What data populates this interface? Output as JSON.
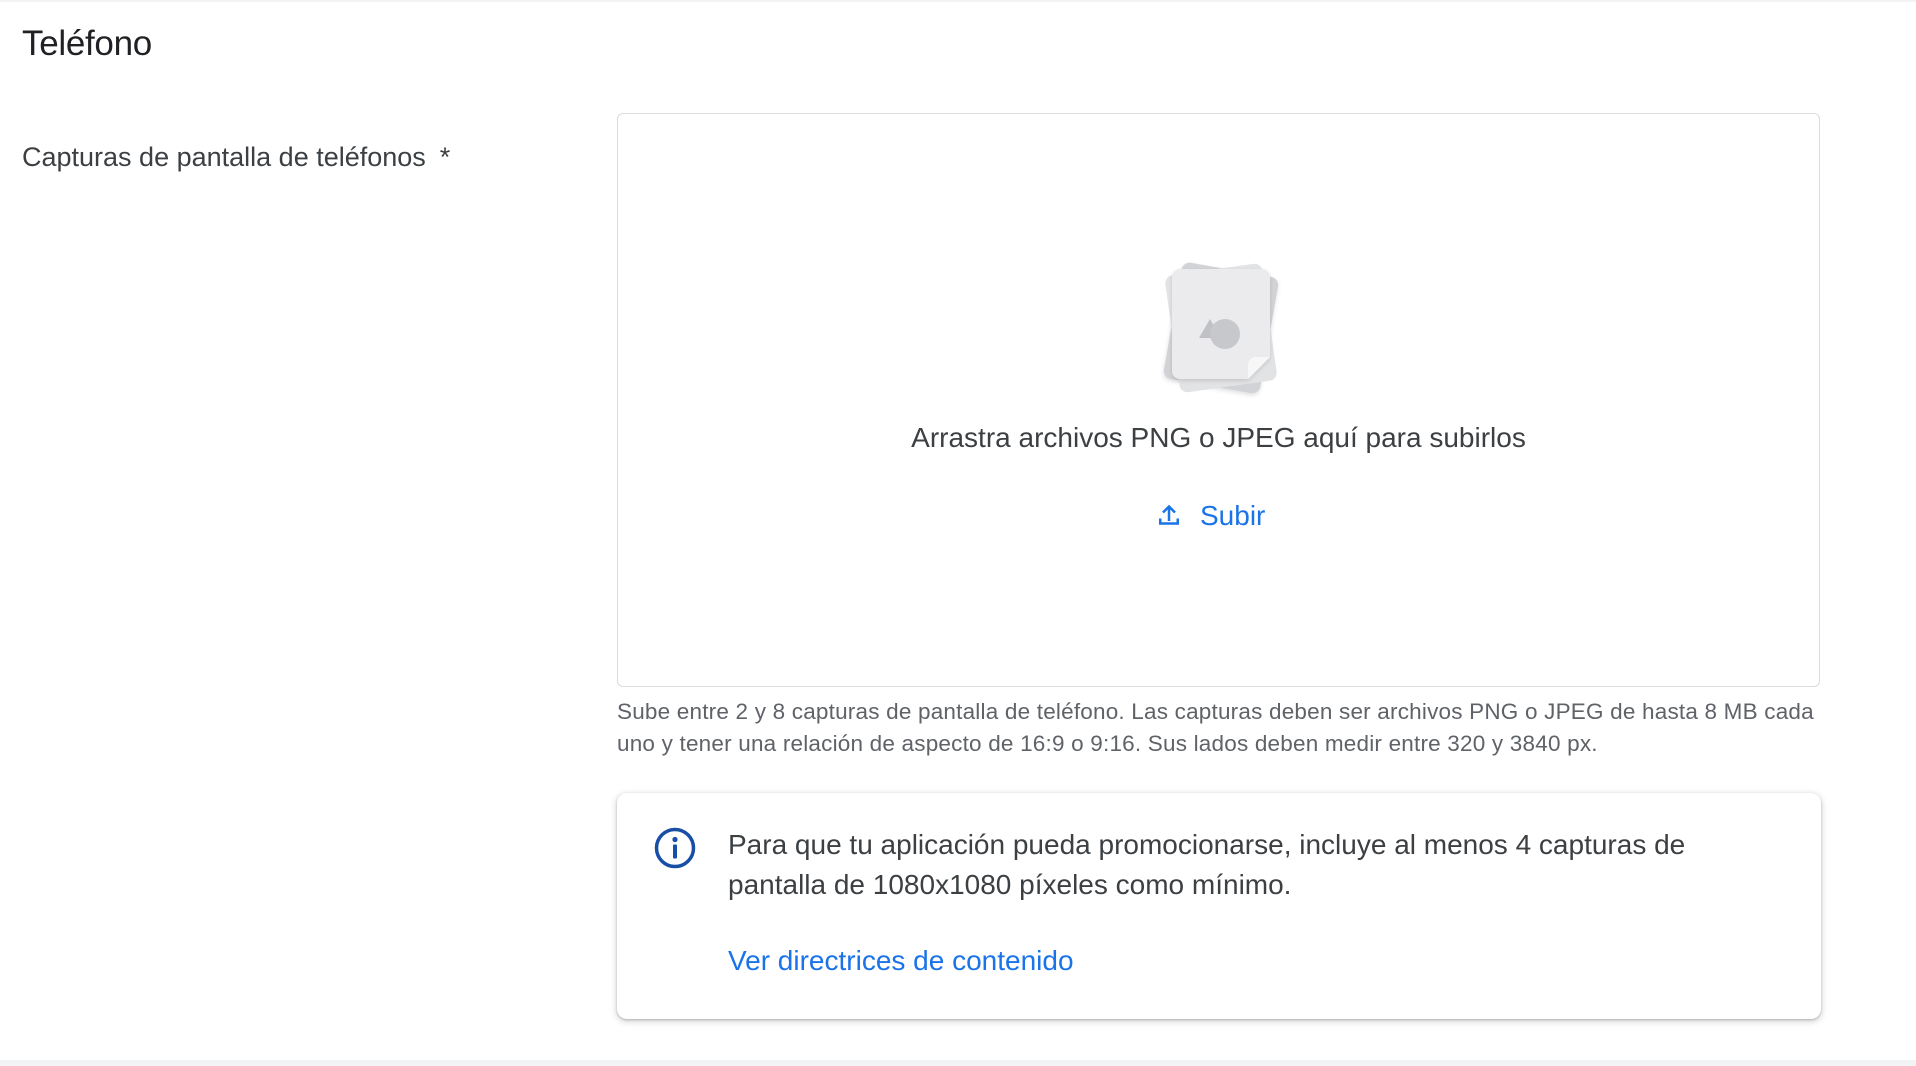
{
  "section": {
    "title": "Teléfono"
  },
  "field": {
    "label": "Capturas de pantalla de teléfonos",
    "required_marker": "*"
  },
  "dropzone": {
    "icon": "image-files-icon",
    "drop_text": "Arrastra archivos PNG o JPEG aquí para subirlos",
    "upload_icon": "upload-icon",
    "upload_label": "Subir"
  },
  "hint": {
    "text": "Sube entre 2 y 8 capturas de pantalla de teléfono. Las capturas deben ser archivos PNG o JPEG de hasta 8 MB cada uno y tener una relación de aspecto de 16:9 o 9:16. Sus lados deben medir entre 320 y 3840 px."
  },
  "info_card": {
    "icon": "info-icon",
    "text": "Para que tu aplicación pueda promocionarse, incluye al menos 4 capturas de pantalla de 1080x1080 píxeles como mínimo.",
    "link_label": "Ver directrices de contenido"
  },
  "colors": {
    "link": "#1a73e8",
    "info_icon": "#174ea6",
    "text": "#3c4043",
    "muted_text": "#5f6368",
    "border": "#dadce0"
  }
}
